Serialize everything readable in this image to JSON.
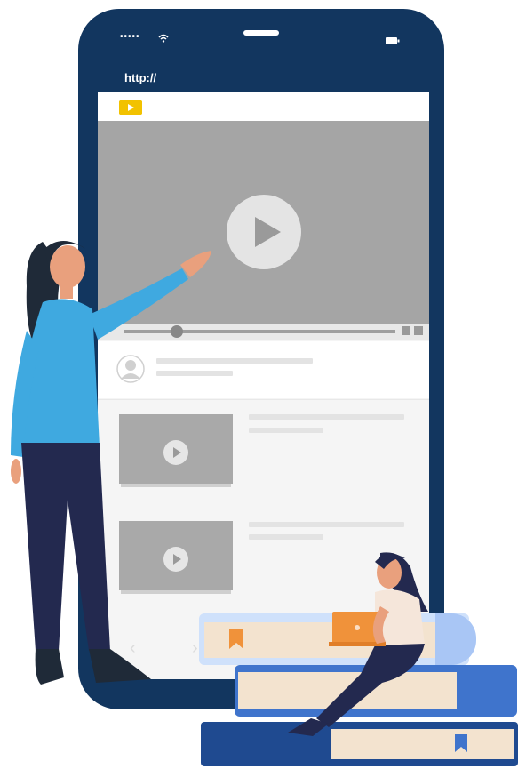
{
  "browser": {
    "signal_dots": "•••••",
    "url": "http://"
  },
  "colors": {
    "phone_frame": "#12365f",
    "badge": "#f2c200",
    "video": "#a5a5a5",
    "shirt": "#3fa9e0",
    "pants": "#23294f",
    "book_light": "#cfe1fb",
    "book_mid": "#3f74cc",
    "book_dark": "#1f4a90",
    "laptop": "#f0923a",
    "bookmark": "#f0923a"
  },
  "icons": {
    "wifi": "wifi-icon",
    "battery": "battery-icon",
    "main_play": "play-icon",
    "avatar": "user-avatar-icon",
    "prev": "chevron-left-icon",
    "next": "chevron-right-icon"
  },
  "nav": {
    "prev": "‹",
    "next": "›"
  }
}
